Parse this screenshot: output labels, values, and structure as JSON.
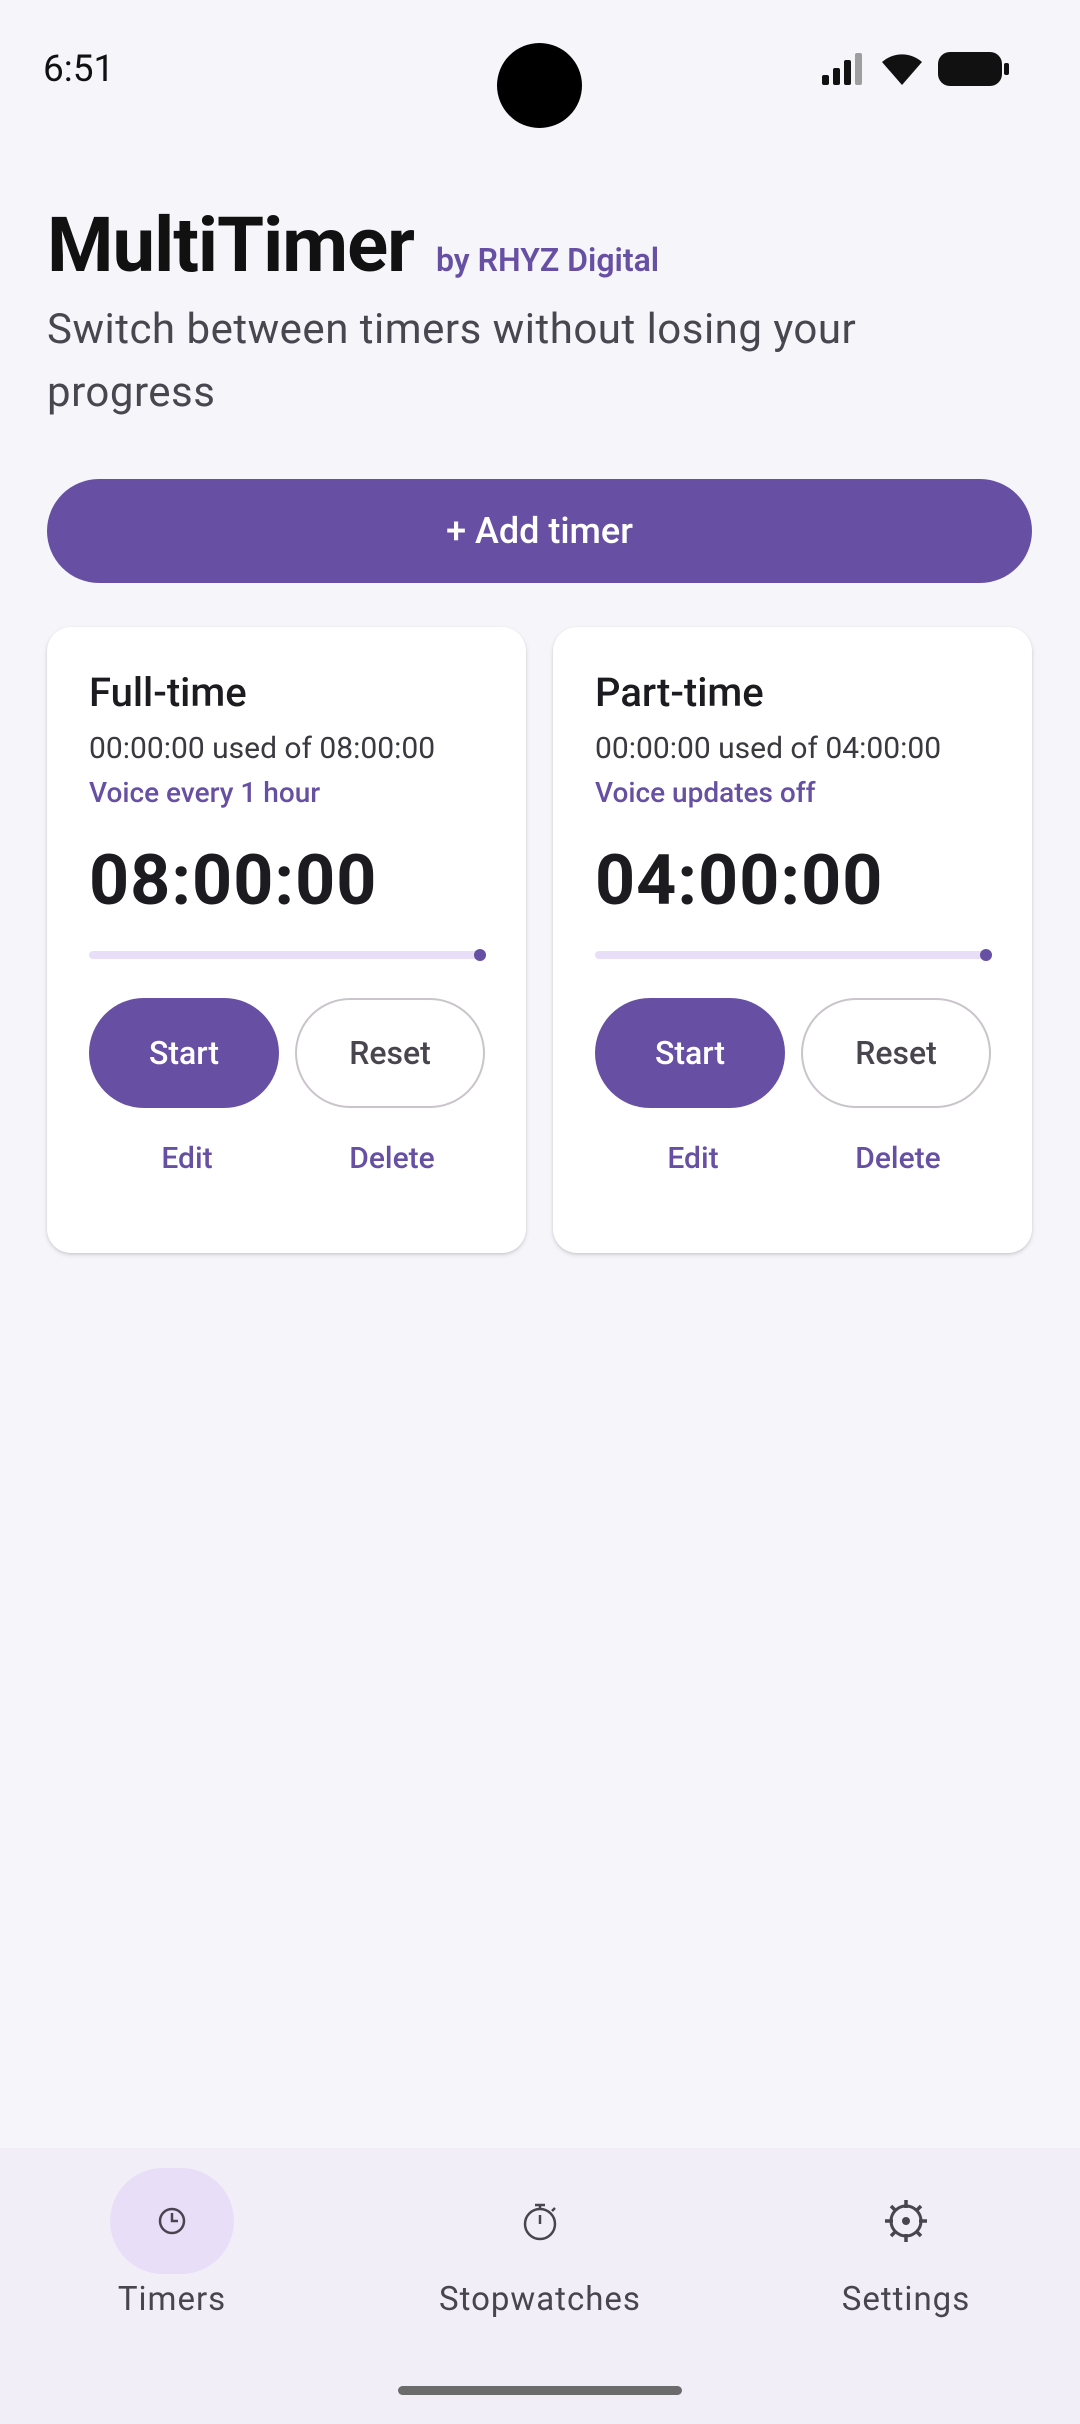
{
  "status": {
    "time": "6:51"
  },
  "header": {
    "title": "MultiTimer",
    "byline": "by RHYZ Digital",
    "subtitle": "Switch between timers without losing your progress"
  },
  "actions": {
    "add_timer": "+ Add timer"
  },
  "timers": [
    {
      "name": "Full-time",
      "used": "00:00:00 used of 08:00:00",
      "voice": "Voice every 1 hour",
      "remaining": "08:00:00",
      "progress_remaining_fraction": 1.0,
      "start_label": "Start",
      "reset_label": "Reset",
      "edit_label": "Edit",
      "delete_label": "Delete"
    },
    {
      "name": "Part-time",
      "used": "00:00:00 used of 04:00:00",
      "voice": "Voice updates off",
      "remaining": "04:00:00",
      "progress_remaining_fraction": 1.0,
      "start_label": "Start",
      "reset_label": "Reset",
      "edit_label": "Edit",
      "delete_label": "Delete"
    }
  ],
  "nav": {
    "items": [
      {
        "label": "Timers",
        "icon": "clock-icon",
        "active": true
      },
      {
        "label": "Stopwatches",
        "icon": "stopwatch-icon",
        "active": false
      },
      {
        "label": "Settings",
        "icon": "gear-icon",
        "active": false
      }
    ]
  },
  "colors": {
    "accent": "#6750a4",
    "background": "#f5f5fa",
    "nav_background": "#f2eef8",
    "active_pill": "#e8def8"
  }
}
